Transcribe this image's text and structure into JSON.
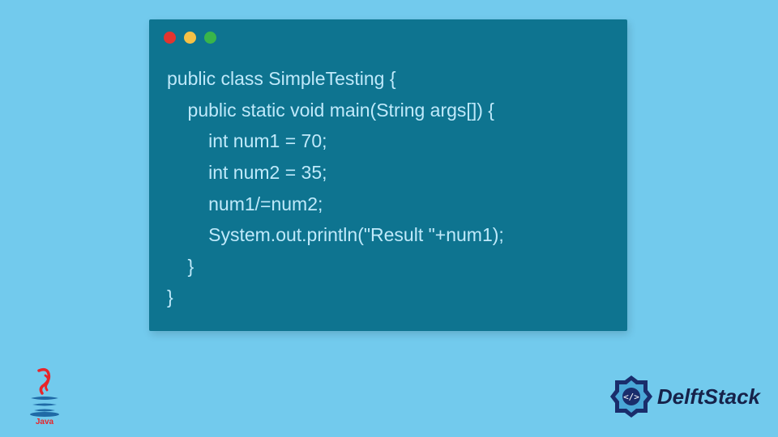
{
  "code": {
    "lines": [
      "public class SimpleTesting {",
      "    public static void main(String args[]) {",
      "        int num1 = 70;",
      "        int num2 = 35;",
      "        num1/=num2;",
      "        System.out.println(\"Result \"+num1);",
      "    }",
      "}"
    ]
  },
  "window": {
    "dots": [
      "red",
      "yellow",
      "green"
    ]
  },
  "logos": {
    "java_label": "Java",
    "delft_label": "DelftStack"
  }
}
